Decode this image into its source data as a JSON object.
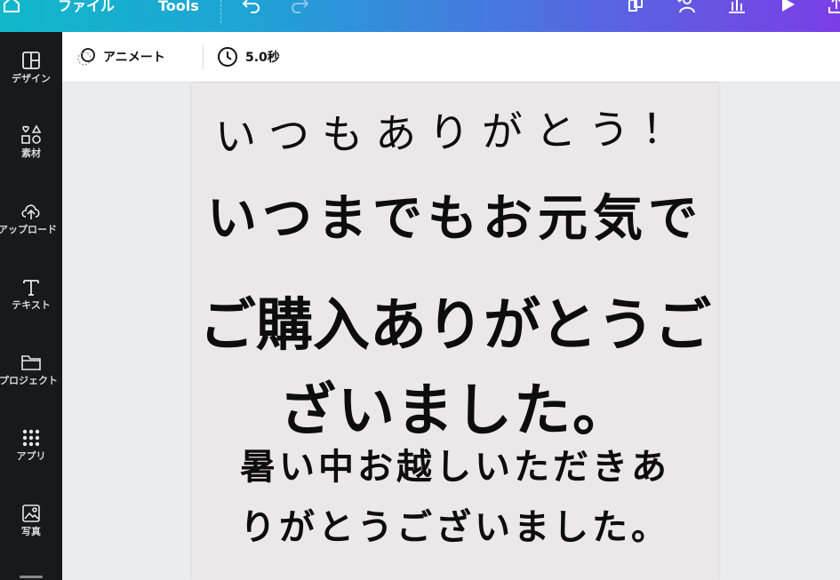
{
  "topbar": {
    "file_label": "ファイル",
    "tools_label": "Tools"
  },
  "sidebar": {
    "items": [
      {
        "label": "デザイン",
        "icon": "layout-icon"
      },
      {
        "label": "素材",
        "icon": "elements-icon"
      },
      {
        "label": "アップロード",
        "icon": "upload-icon"
      },
      {
        "label": "テキスト",
        "icon": "text-icon"
      },
      {
        "label": "プロジェクト",
        "icon": "folder-icon"
      },
      {
        "label": "アプリ",
        "icon": "apps-icon"
      },
      {
        "label": "写真",
        "icon": "photo-icon"
      }
    ]
  },
  "toolbar": {
    "animate_label": "アニメート",
    "duration_label": "5.0秒"
  },
  "page": {
    "lines": [
      "いつもありがとう！",
      "いつまでもお元気で",
      "ご購入ありがとうご",
      "ざいました。",
      "暑い中お越しいただきあ",
      "りがとうございました。"
    ]
  },
  "colors": {
    "sidebar_bg": "#18191b",
    "page_bg": "#ece8e9",
    "gradient_start": "#11b8c9",
    "gradient_end": "#7a3ee6"
  }
}
